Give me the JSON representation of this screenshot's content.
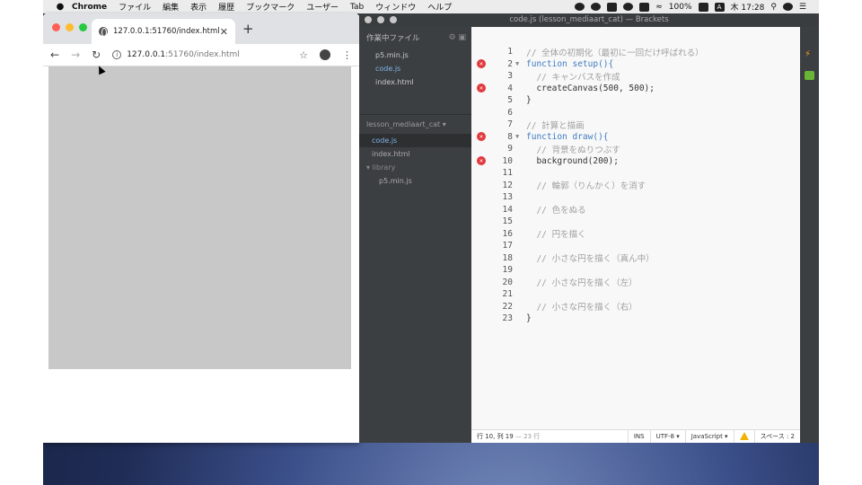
{
  "menubar": {
    "app": "Chrome",
    "items": [
      "ファイル",
      "編集",
      "表示",
      "履歴",
      "ブックマーク",
      "ユーザー",
      "Tab",
      "ウィンドウ",
      "ヘルプ"
    ],
    "battery": "100%",
    "input_source": "A",
    "clock": "木 17:28"
  },
  "chrome": {
    "tab_title": "127.0.0.1:51760/index.html",
    "url_host": "127.0.0.1",
    "url_path": ":51760/index.html"
  },
  "brackets": {
    "window_title": "code.js (lesson_mediaart_cat) — Brackets",
    "working_files_header": "作業中ファイル",
    "working_files": [
      "p5.min.js",
      "code.js",
      "index.html"
    ],
    "project_name": "lesson_mediaart_cat",
    "project_files": [
      "code.js",
      "index.html"
    ],
    "folder": "library",
    "folder_files": [
      "p5.min.js"
    ],
    "code_lines": [
      {
        "n": "1",
        "text": "// 全体の初期化（最初に一回だけ呼ばれる）",
        "cls": "c-com",
        "err": false,
        "fold": false
      },
      {
        "n": "2",
        "text": "function setup(){",
        "cls": "c-kw",
        "err": true,
        "fold": true
      },
      {
        "n": "3",
        "text": "  // キャンバスを作成",
        "cls": "c-com",
        "err": false,
        "fold": false
      },
      {
        "n": "4",
        "text": "  createCanvas(500, 500);",
        "cls": "c-def",
        "err": true,
        "fold": false
      },
      {
        "n": "5",
        "text": "}",
        "cls": "c-def",
        "err": false,
        "fold": false
      },
      {
        "n": "6",
        "text": "",
        "cls": "c-def",
        "err": false,
        "fold": false
      },
      {
        "n": "7",
        "text": "// 計算と描画",
        "cls": "c-com",
        "err": false,
        "fold": false
      },
      {
        "n": "8",
        "text": "function draw(){",
        "cls": "c-kw",
        "err": true,
        "fold": true
      },
      {
        "n": "9",
        "text": "  // 背景をぬりつぶす",
        "cls": "c-com",
        "err": false,
        "fold": false
      },
      {
        "n": "10",
        "text": "  background(200);",
        "cls": "c-def",
        "err": true,
        "fold": false
      },
      {
        "n": "11",
        "text": "",
        "cls": "c-def",
        "err": false,
        "fold": false
      },
      {
        "n": "12",
        "text": "  // 輪郭（りんかく）を消す",
        "cls": "c-com",
        "err": false,
        "fold": false
      },
      {
        "n": "13",
        "text": "",
        "cls": "c-def",
        "err": false,
        "fold": false
      },
      {
        "n": "14",
        "text": "  // 色をぬる",
        "cls": "c-com",
        "err": false,
        "fold": false
      },
      {
        "n": "15",
        "text": "",
        "cls": "c-def",
        "err": false,
        "fold": false
      },
      {
        "n": "16",
        "text": "  // 円を描く",
        "cls": "c-com",
        "err": false,
        "fold": false
      },
      {
        "n": "17",
        "text": "",
        "cls": "c-def",
        "err": false,
        "fold": false
      },
      {
        "n": "18",
        "text": "  // 小さな円を描く（真ん中）",
        "cls": "c-com",
        "err": false,
        "fold": false
      },
      {
        "n": "19",
        "text": "",
        "cls": "c-def",
        "err": false,
        "fold": false
      },
      {
        "n": "20",
        "text": "  // 小さな円を描く（左）",
        "cls": "c-com",
        "err": false,
        "fold": false
      },
      {
        "n": "21",
        "text": "",
        "cls": "c-def",
        "err": false,
        "fold": false
      },
      {
        "n": "22",
        "text": "  // 小さな円を描く（右）",
        "cls": "c-com",
        "err": false,
        "fold": false
      },
      {
        "n": "23",
        "text": "}",
        "cls": "c-def",
        "err": false,
        "fold": false
      }
    ],
    "status": {
      "cursor": "行 10, 列 19",
      "lines": "— 23 行",
      "mode": "INS",
      "encoding": "UTF-8 ▾",
      "language": "JavaScript ▾",
      "indent": "スペース : 2"
    }
  }
}
